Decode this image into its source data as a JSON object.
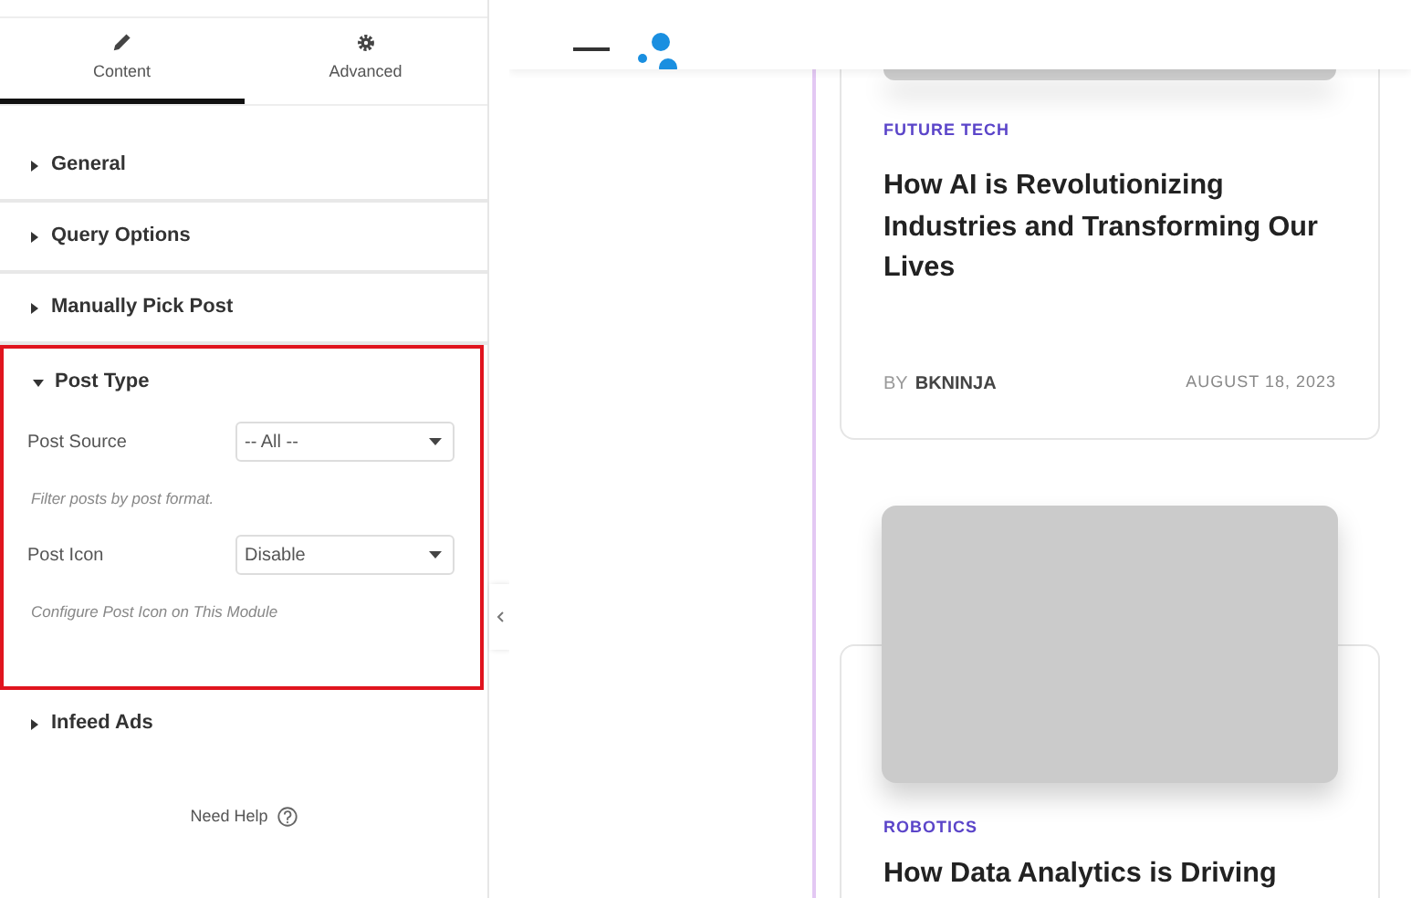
{
  "panel": {
    "tabs": [
      {
        "label": "Content",
        "selected": true
      },
      {
        "label": "Advanced",
        "selected": false
      }
    ],
    "sections": [
      {
        "title": "General",
        "expanded": false,
        "highlighted": false
      },
      {
        "title": "Query Options",
        "expanded": false,
        "highlighted": false
      },
      {
        "title": "Manually Pick Post",
        "expanded": false,
        "highlighted": false
      },
      {
        "title": "Post Type",
        "expanded": true,
        "highlighted": true,
        "controls": [
          {
            "label": "Post Source",
            "value": "-- All --",
            "help": "Filter posts by post format."
          },
          {
            "label": "Post Icon",
            "value": "Disable",
            "help": "Configure Post Icon on This Module"
          }
        ]
      },
      {
        "title": "Infeed Ads",
        "expanded": false,
        "highlighted": false
      }
    ],
    "help": "Need Help"
  },
  "site": {
    "posts": [
      {
        "category": "FUTURE TECH",
        "title": "How AI is Revolutionizing Industries and Transforming Our Lives",
        "by": "BY",
        "author": "BKNINJA",
        "date": "AUGUST 18, 2023"
      },
      {
        "category": "ROBOTICS",
        "title": "How Data Analytics is Driving"
      }
    ]
  }
}
